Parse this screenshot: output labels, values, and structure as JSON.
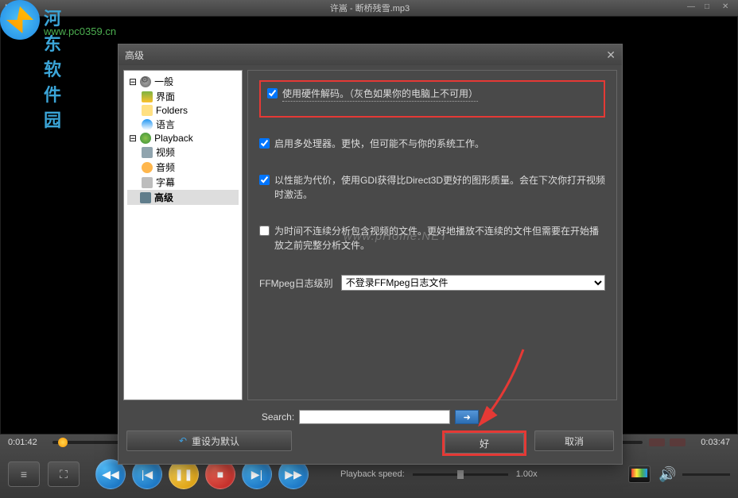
{
  "watermark": {
    "text1": "河东软件园",
    "text2": "www.pc0359.cn",
    "center": "www.pHome.NET"
  },
  "titlebar": {
    "left": "MP",
    "center": "许嵩 - 断桥残雪.mp3"
  },
  "seek": {
    "left_time": "0:01:42",
    "right_time": "0:03:47"
  },
  "playback": {
    "speed_label": "Playback speed:",
    "speed_value": "1.00x"
  },
  "dialog": {
    "title": "高级",
    "tree": {
      "general": "一般",
      "interface": "界面",
      "folders": "Folders",
      "language": "语言",
      "playback": "Playback",
      "video": "视频",
      "audio": "音频",
      "subtitle": "字幕",
      "advanced": "高级"
    },
    "options": {
      "hw_decode": "使用硬件解码。（灰色如果你的电脑上不可用）",
      "multiproc": "启用多处理器。更快，但可能不与你的系统工作。",
      "gdi": "以性能为代价，使用GDI获得比Direct3D更好的图形质量。会在下次你打开视频时激活。",
      "analyze": "为时间不连续分析包含视频的文件。更好地播放不连续的文件但需要在开始播放之前完整分析文件。",
      "ffmpeg_label": "FFMpeg日志级别",
      "ffmpeg_value": "不登录FFMpeg日志文件"
    },
    "search_label": "Search:",
    "reset": "重设为默认",
    "ok": "好",
    "cancel": "取消"
  }
}
